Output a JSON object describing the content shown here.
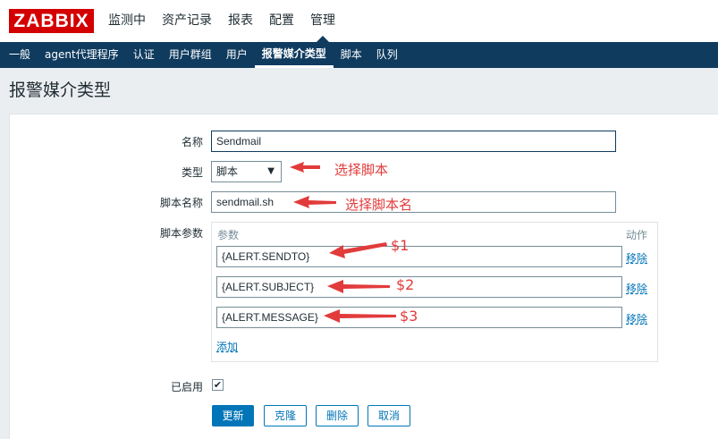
{
  "logo": "ZABBIX",
  "main_nav": [
    "监测中",
    "资产记录",
    "报表",
    "配置",
    "管理"
  ],
  "sub_nav": [
    "一般",
    "agent代理程序",
    "认证",
    "用户群组",
    "用户",
    "报警媒介类型",
    "脚本",
    "队列"
  ],
  "page_title": "报警媒介类型",
  "form": {
    "name_label": "名称",
    "name_value": "Sendmail",
    "type_label": "类型",
    "type_value": "脚本",
    "script_name_label": "脚本名称",
    "script_name_value": "sendmail.sh",
    "script_params_label": "脚本参数",
    "params_header": "参数",
    "actions_header": "动作",
    "params": [
      {
        "value": "{ALERT.SENDTO}",
        "remove": "移除"
      },
      {
        "value": "{ALERT.SUBJECT}",
        "remove": "移除"
      },
      {
        "value": "{ALERT.MESSAGE}",
        "remove": "移除"
      }
    ],
    "add_link": "添加",
    "enabled_label": "已启用",
    "enabled_checked": true
  },
  "buttons": {
    "update": "更新",
    "clone": "克隆",
    "delete": "删除",
    "cancel": "取消"
  },
  "annotations": {
    "type": "选择脚本",
    "script_name": "选择脚本名",
    "p1": "$1",
    "p2": "$2",
    "p3": "$3"
  },
  "colors": {
    "brand": "#d40000",
    "nav_bg": "#0f3b5f",
    "link": "#0275b8",
    "annotation": "#e23b3b"
  }
}
